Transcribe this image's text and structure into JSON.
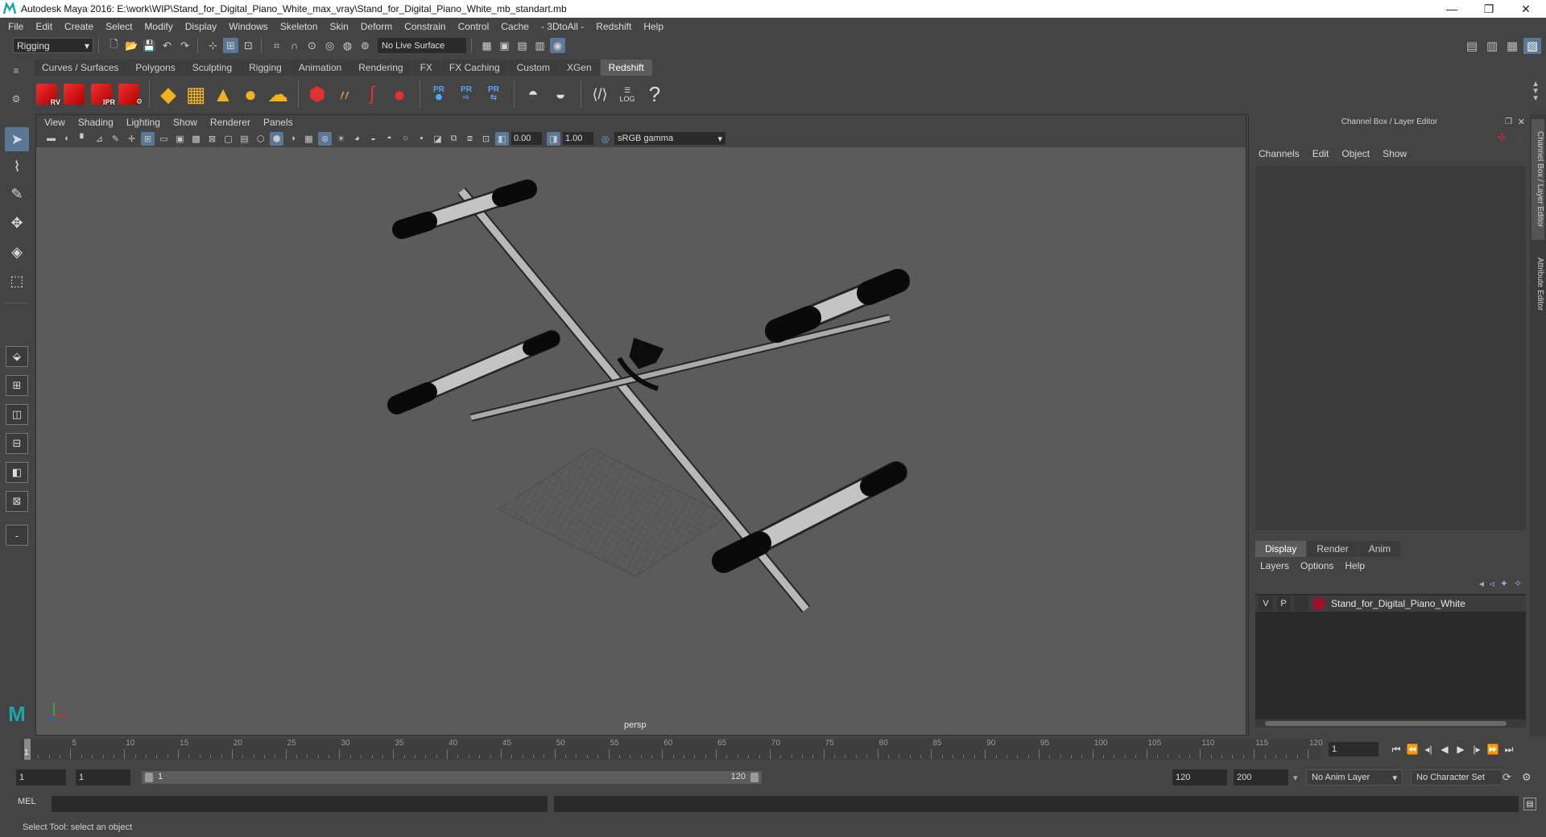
{
  "window": {
    "title": "Autodesk Maya 2016: E:\\work\\WIP\\Stand_for_Digital_Piano_White_max_vray\\Stand_for_Digital_Piano_White_mb_standart.mb",
    "minimize": "—",
    "restore": "❐",
    "close": "✕"
  },
  "menubar": [
    "File",
    "Edit",
    "Create",
    "Select",
    "Modify",
    "Display",
    "Windows",
    "Skeleton",
    "Skin",
    "Deform",
    "Constrain",
    "Control",
    "Cache",
    "- 3DtoAll -",
    "Redshift",
    "Help"
  ],
  "statusline": {
    "mode": "Rigging",
    "live_surface": "No Live Surface"
  },
  "shelf": {
    "tabs": [
      "Curves / Surfaces",
      "Polygons",
      "Sculpting",
      "Rigging",
      "Animation",
      "Rendering",
      "FX",
      "FX Caching",
      "Custom",
      "XGen",
      "Redshift"
    ],
    "active_tab": "Redshift",
    "cube_labels": [
      "RV",
      "",
      "IPR",
      ""
    ],
    "pr_label": "PR",
    "log_label": "LOG",
    "help_icon": "?"
  },
  "viewport": {
    "menu": [
      "View",
      "Shading",
      "Lighting",
      "Show",
      "Renderer",
      "Panels"
    ],
    "exposure": "0.00",
    "gamma_value": "1.00",
    "color_space": "sRGB gamma",
    "camera": "persp"
  },
  "channel_box": {
    "title": "Channel Box / Layer Editor",
    "menu": [
      "Channels",
      "Edit",
      "Object",
      "Show"
    ]
  },
  "layer_editor": {
    "tabs": [
      "Display",
      "Render",
      "Anim"
    ],
    "active_tab": "Display",
    "menu": [
      "Layers",
      "Options",
      "Help"
    ],
    "layers": [
      {
        "v": "V",
        "p": "P",
        "color": "#a0102a",
        "name": "Stand_for_Digital_Piano_White"
      }
    ]
  },
  "side_tabs": [
    "Channel Box / Layer Editor",
    "Attribute Editor"
  ],
  "time_slider": {
    "ticks": [
      "5",
      "10",
      "15",
      "20",
      "25",
      "30",
      "35",
      "40",
      "45",
      "50",
      "55",
      "60",
      "65",
      "70",
      "75",
      "80",
      "85",
      "90",
      "95",
      "100",
      "105",
      "110",
      "115",
      "120"
    ],
    "current_frame": "1",
    "current_frame_field": "1"
  },
  "range_slider": {
    "start_field": "1",
    "playback_start": "1",
    "range_start": "1",
    "range_end": "120",
    "playback_end": "120",
    "end_field": "200",
    "anim_layer": "No Anim Layer",
    "character_set": "No Character Set"
  },
  "command_line": {
    "label": "MEL"
  },
  "help_line": {
    "text": "Select Tool: select an object"
  },
  "colors": {
    "active_blue": "#5a7896",
    "redshift_red": "#d81e1e",
    "shelf_gold": "#f2b21f",
    "layer_color": "#a0102a"
  }
}
